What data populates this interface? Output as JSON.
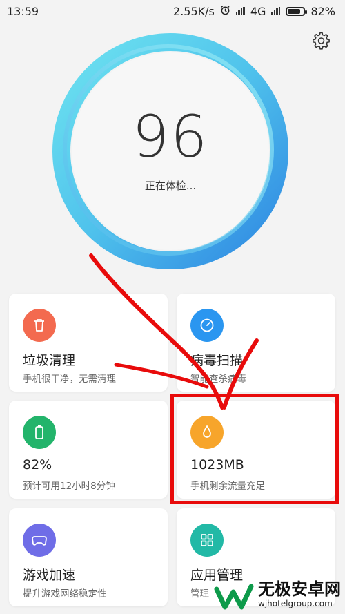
{
  "status_bar": {
    "time": "13:59",
    "speed": "2.55K/s",
    "network": "4G",
    "battery_percent": "82%",
    "battery_level": 0.82
  },
  "header": {
    "settings_icon": "gear-icon"
  },
  "score": {
    "value": "96",
    "status": "正在体检..."
  },
  "cards": [
    {
      "title": "垃圾清理",
      "subtitle": "手机很干净，无需清理",
      "icon": "trash-icon",
      "color": "#f36a4f"
    },
    {
      "title": "病毒扫描",
      "subtitle": "智能查杀病毒",
      "icon": "gauge-icon",
      "color": "#2a96f0"
    },
    {
      "title": "82%",
      "subtitle": "预计可用12小时8分钟",
      "icon": "battery-icon",
      "color": "#23b46b"
    },
    {
      "title": "1023MB",
      "subtitle": "手机剩余流量充足",
      "icon": "drop-icon",
      "color": "#f7a52b"
    },
    {
      "title": "游戏加速",
      "subtitle": "提升游戏网络稳定性",
      "icon": "gamepad-icon",
      "color": "#6f6de7"
    },
    {
      "title": "应用管理",
      "subtitle": "管理",
      "icon": "apps-grid-icon",
      "color": "#22b9a6"
    }
  ],
  "watermark": {
    "brand": "无极安卓网",
    "domain": "wjhotelgroup.com"
  },
  "colors": {
    "ring_outer": "#2e8fe4",
    "ring_inner": "#5fd9ee",
    "annotation": "#e80b0b"
  }
}
